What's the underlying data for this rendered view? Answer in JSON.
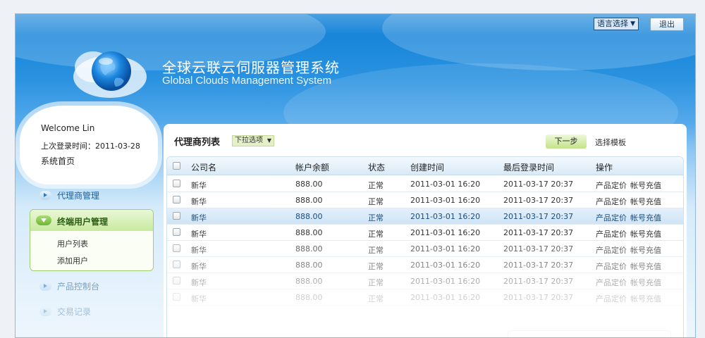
{
  "header": {
    "language_select": "语言选择",
    "logout": "退出",
    "title_cn": "全球云联云伺服器管理系统",
    "title_en": "Global Clouds Management System"
  },
  "welcome": {
    "greeting": "Welcome Lin",
    "last_login": "上次登录时间：2011-03-28",
    "home": "系统首页"
  },
  "sidebar": {
    "items": [
      {
        "label": "代理商管理"
      },
      {
        "label": "终端用户管理",
        "active": true,
        "sub": [
          "用户列表",
          "添加用户"
        ]
      },
      {
        "label": "产品控制台"
      },
      {
        "label": "交易记录"
      }
    ]
  },
  "panel": {
    "title": "代理商列表",
    "dropdown": "下拉选项",
    "next_button": "下一步",
    "template_link": "选择模板"
  },
  "table": {
    "columns": [
      "公司名",
      "帐户余额",
      "状态",
      "创建时间",
      "最后登录时间",
      "操作"
    ],
    "rows": [
      {
        "name": "新华",
        "balance": "888.00",
        "status": "正常",
        "created": "2011-03-01 16:20",
        "last_login": "2011-03-17 20:37",
        "op1": "产品定价",
        "op2": "帐号充值"
      },
      {
        "name": "新华",
        "balance": "888.00",
        "status": "正常",
        "created": "2011-03-01 16:20",
        "last_login": "2011-03-17 20:37",
        "op1": "产品定价",
        "op2": "帐号充值"
      },
      {
        "name": "新华",
        "balance": "888.00",
        "status": "正常",
        "created": "2011-03-01 16:20",
        "last_login": "2011-03-17 20:37",
        "op1": "产品定价",
        "op2": "帐号充值",
        "selected": true
      },
      {
        "name": "新华",
        "balance": "888.00",
        "status": "正常",
        "created": "2011-03-01 16:20",
        "last_login": "2011-03-17 20:37",
        "op1": "产品定价",
        "op2": "帐号充值"
      },
      {
        "name": "新华",
        "balance": "888.00",
        "status": "正常",
        "created": "2011-03-01 16:20",
        "last_login": "2011-03-17 20:37",
        "op1": "产品定价",
        "op2": "帐号充值"
      },
      {
        "name": "新华",
        "balance": "888.00",
        "status": "正常",
        "created": "2011-03-01 16:20",
        "last_login": "2011-03-17 20:37",
        "op1": "产品定价",
        "op2": "帐号充值"
      },
      {
        "name": "新华",
        "balance": "888.00",
        "status": "正常",
        "created": "2011-03-01 16:20",
        "last_login": "2011-03-17 20:37",
        "op1": "产品定价",
        "op2": "帐号充值"
      },
      {
        "name": "新华",
        "balance": "888.00",
        "status": "正常",
        "created": "2011-03-01 16:20",
        "last_login": "2011-03-17 20:37",
        "op1": "产品定价",
        "op2": "帐号充值"
      }
    ]
  },
  "colors": {
    "brand_blue": "#0f7fd6",
    "accent_green": "#c2e28a",
    "selected_row": "#cfe4f6"
  },
  "icons": [
    "globe-logo-icon",
    "dropdown-arrow-icon",
    "nav-bullet-icon",
    "checkbox-icon"
  ]
}
